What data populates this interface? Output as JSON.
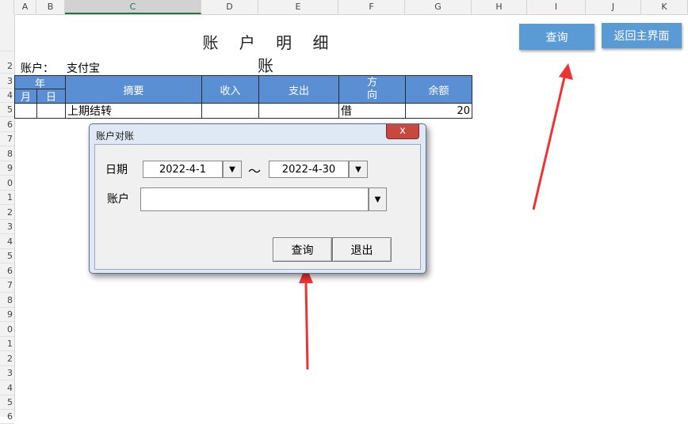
{
  "columns": [
    "A",
    "B",
    "C",
    "D",
    "E",
    "F",
    "G",
    "H",
    "I",
    "J",
    "K"
  ],
  "rows": [
    "",
    "2",
    "3",
    "4",
    "5",
    "6",
    "7",
    "8",
    "9",
    "0",
    "1",
    "2",
    "3",
    "4",
    "5",
    "6",
    "7",
    "8",
    "9",
    "0",
    "1",
    "2",
    "3",
    "4",
    "5",
    "6"
  ],
  "sheet": {
    "title": "账 户 明 细 账",
    "account_label": "账户：",
    "account_value": "支付宝",
    "headers": {
      "year": "年",
      "month": "月",
      "day": "日",
      "summary": "摘要",
      "income": "收入",
      "expense": "支出",
      "direction": "方向",
      "balance": "余额"
    },
    "row1": {
      "summary": "上期结转",
      "direction": "借",
      "balance": "20"
    }
  },
  "buttons": {
    "query": "查询",
    "back_main": "返回主界面"
  },
  "dialog": {
    "title": "账户对账",
    "close": "x",
    "date_label": "日期",
    "date_from": "2022-4-1",
    "tilde": "～",
    "date_to": "2022-4-30",
    "account_label": "账户",
    "account_value": "",
    "dropdown_glyph": "▼",
    "query_button": "查询",
    "exit_button": "退出"
  },
  "colors": {
    "header_blue": "#5b8fd4",
    "button_blue": "#5b9bd5",
    "arrow_red": "#ee3333"
  }
}
